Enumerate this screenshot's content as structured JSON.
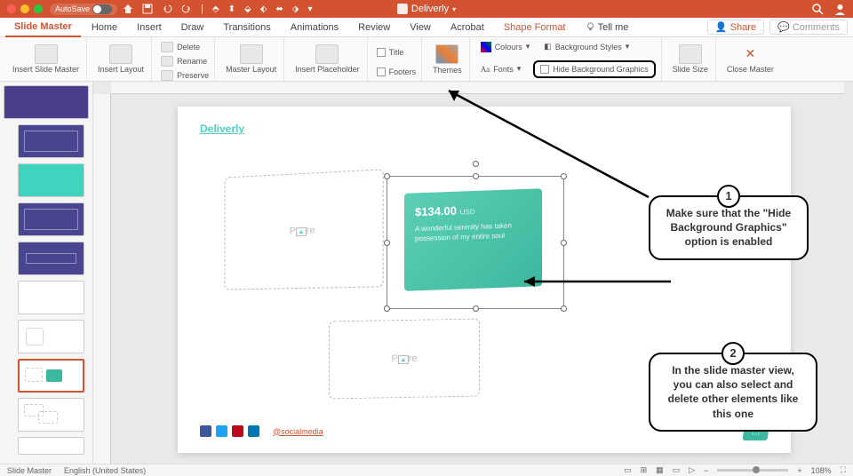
{
  "titlebar": {
    "autosave_label": "AutoSave",
    "doc_title": "Deliverly"
  },
  "tabs": {
    "items": [
      "Slide Master",
      "Home",
      "Insert",
      "Draw",
      "Transitions",
      "Animations",
      "Review",
      "View",
      "Acrobat",
      "Shape Format"
    ],
    "tell_me": "Tell me",
    "share": "Share",
    "comments": "Comments"
  },
  "ribbon": {
    "insert_slide_master": "Insert Slide\nMaster",
    "insert_layout": "Insert\nLayout",
    "delete": "Delete",
    "rename": "Rename",
    "preserve": "Preserve",
    "master_layout": "Master\nLayout",
    "insert_placeholder": "Insert\nPlaceholder",
    "title": "Title",
    "footers": "Footers",
    "themes": "Themes",
    "fonts": "Fonts",
    "colours": "Colours",
    "bg_styles": "Background Styles",
    "hide_bg": "Hide Background Graphics",
    "slide_size": "Slide\nSize",
    "close_master": "Close\nMaster"
  },
  "slide": {
    "brand": "Deliverly",
    "placeholder": "Picture",
    "card_price": "$134.00",
    "card_currency": "USD",
    "card_desc": "A wonderful serenity has taken possession of my entire soul",
    "social_handle": "@socialmedia"
  },
  "callouts": {
    "c1_num": "1",
    "c1_text": "Make sure that the \"Hide Background Graphics\" option is enabled",
    "c2_num": "2",
    "c2_text": "In the slide master view, you can also select and delete other elements like this one"
  },
  "status": {
    "mode": "Slide Master",
    "lang": "English (United States)",
    "zoom": "108%"
  }
}
